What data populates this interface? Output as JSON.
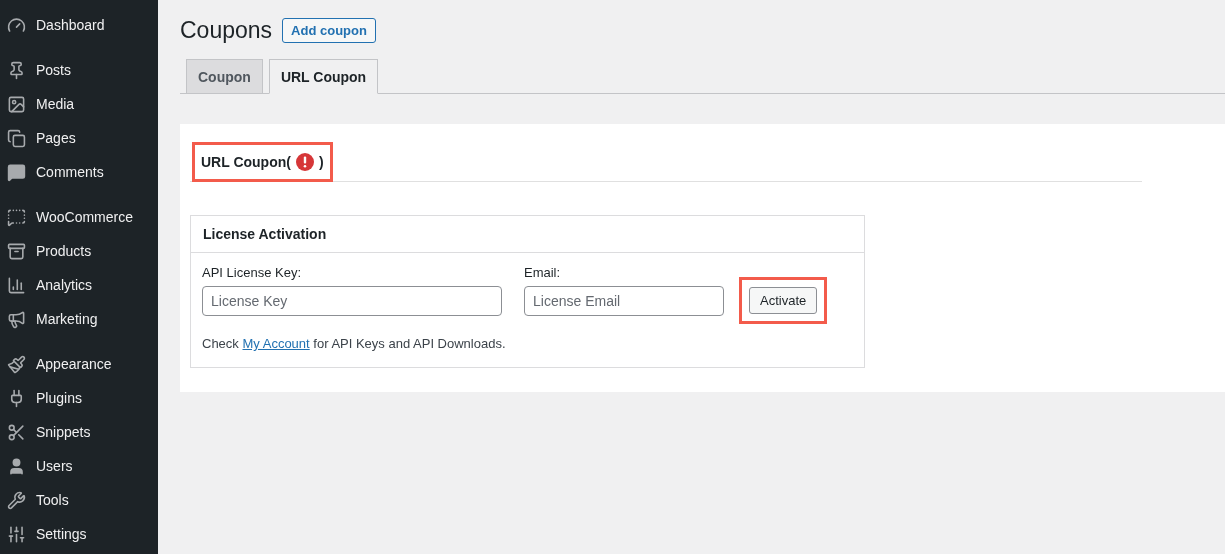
{
  "sidebar": {
    "groups": [
      {
        "items": [
          {
            "label": "Dashboard"
          }
        ]
      },
      {
        "items": [
          {
            "label": "Posts"
          },
          {
            "label": "Media"
          },
          {
            "label": "Pages"
          },
          {
            "label": "Comments"
          }
        ]
      },
      {
        "items": [
          {
            "label": "WooCommerce"
          },
          {
            "label": "Products"
          },
          {
            "label": "Analytics"
          },
          {
            "label": "Marketing"
          }
        ]
      },
      {
        "items": [
          {
            "label": "Appearance"
          },
          {
            "label": "Plugins"
          },
          {
            "label": "Snippets"
          },
          {
            "label": "Users"
          },
          {
            "label": "Tools"
          },
          {
            "label": "Settings"
          }
        ]
      }
    ]
  },
  "page": {
    "title": "Coupons",
    "add_button": "Add coupon"
  },
  "tabs": [
    {
      "label": "Coupon",
      "selected": false
    },
    {
      "label": "URL Coupon",
      "selected": true
    }
  ],
  "section": {
    "heading": "URL Coupon(",
    "heading_end": ")",
    "warning": true,
    "highlighted": true
  },
  "license_card": {
    "title": "License Activation",
    "fields": [
      {
        "label": "API License Key:",
        "placeholder": "License Key"
      },
      {
        "label": "Email:",
        "placeholder": "License Email"
      }
    ],
    "button": {
      "label": "Activate",
      "highlighted": true
    },
    "note_before": "Check",
    "note_link": "My Account",
    "note_after": "for API Keys and API Downloads."
  }
}
